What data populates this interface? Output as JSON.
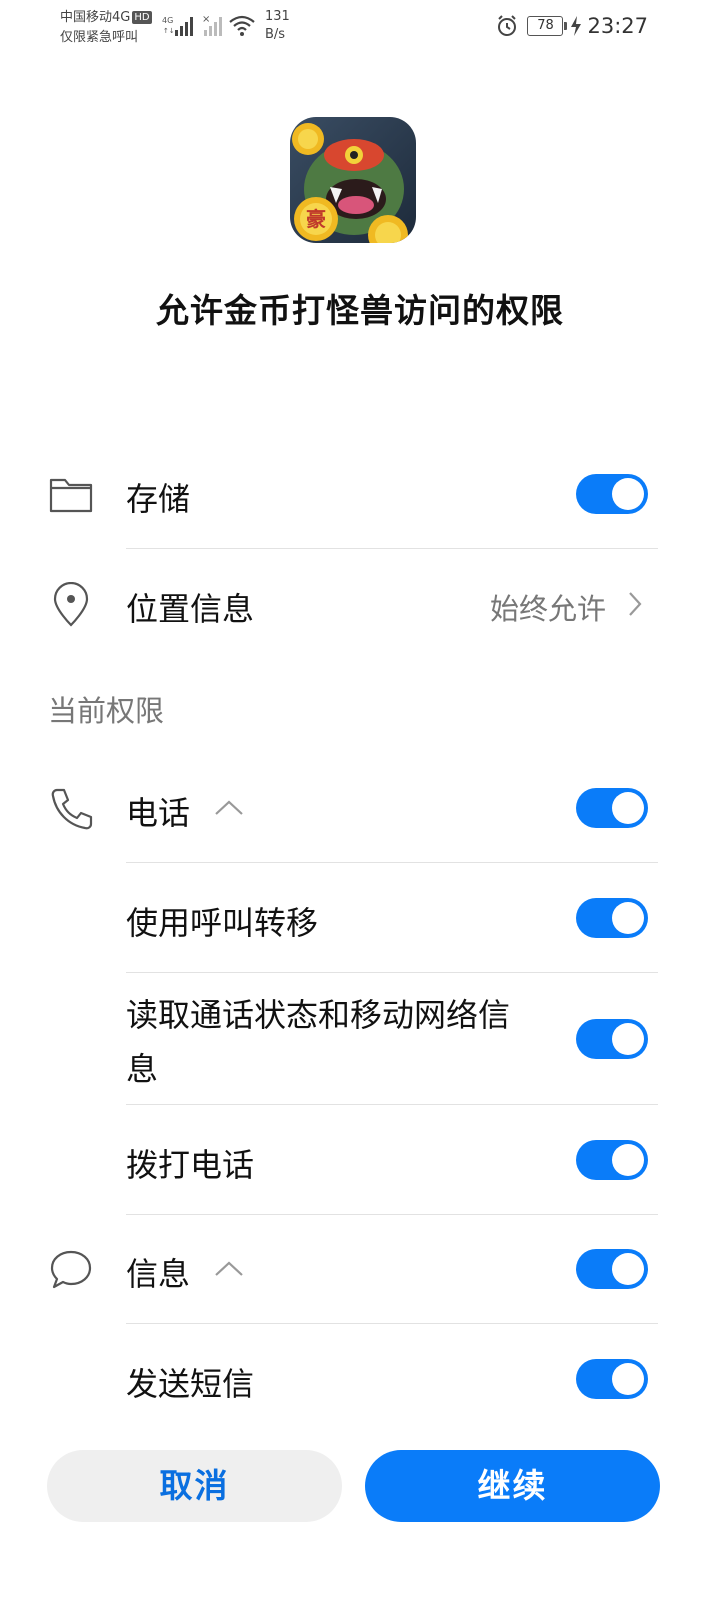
{
  "status_bar": {
    "carrier": "中国移动4G",
    "hd_badge": "HD",
    "emergency": "仅限紧急呼叫",
    "net_type": "4G",
    "net_speed_value": "131",
    "net_speed_unit": "B/s",
    "battery": "78",
    "time": "23:27"
  },
  "header": {
    "app_icon_badge": "豪",
    "title": "允许金币打怪兽访问的权限"
  },
  "permissions": {
    "storage_label": "存储",
    "storage_enabled": true,
    "location_label": "位置信息",
    "location_value": "始终允许"
  },
  "section": {
    "current_label": "当前权限"
  },
  "phone_group": {
    "label": "电话",
    "enabled": true,
    "items": [
      {
        "label": "使用呼叫转移",
        "enabled": true
      },
      {
        "label": "读取通话状态和移动网络信息",
        "enabled": true
      },
      {
        "label": "拨打电话",
        "enabled": true
      }
    ]
  },
  "sms_group": {
    "label": "信息",
    "enabled": true,
    "items": [
      {
        "label": "发送短信",
        "enabled": true
      }
    ]
  },
  "buttons": {
    "cancel": "取消",
    "continue": "继续"
  },
  "colors": {
    "accent": "#0a7cf9",
    "cancel_text": "#0a6fe0"
  }
}
